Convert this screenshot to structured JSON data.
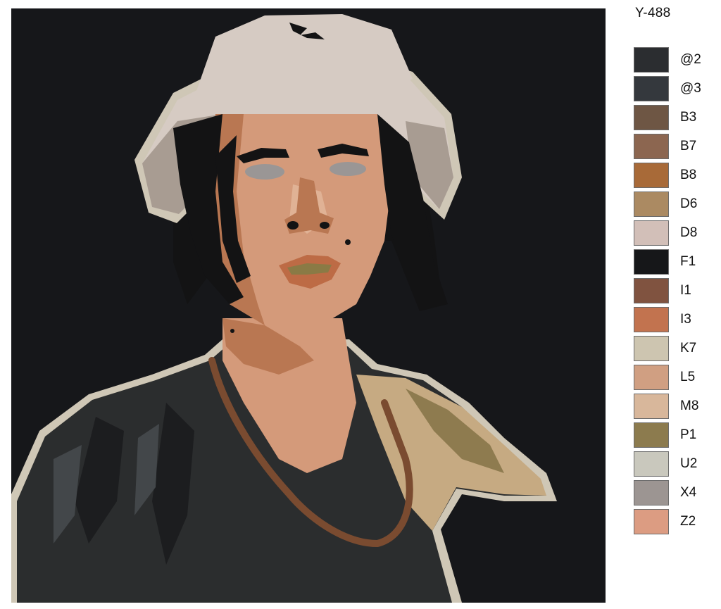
{
  "product_code": "Y-488",
  "artwork": {
    "colors": {
      "background": "#16171a",
      "outline": "#cfc7b6",
      "skin": "#d49a7a",
      "skin_shadow": "#b97752",
      "skin_light": "#e0b295",
      "hair": "#131314",
      "hat": "#d6cbc3",
      "hat_shadow": "#a89c92",
      "shirt": "#2b2d2e",
      "shirt_dark": "#1c1d1f",
      "shirt_light": "#43474a",
      "eyes": "#9a9695",
      "lips": "#bd6b45",
      "teeth": "#8a7a45",
      "necklace": "#7a4b30",
      "shoulder": "#c6aa82",
      "shoulder_shadow": "#8e7b4f"
    }
  },
  "palette": [
    {
      "code": "@2",
      "color": "#2b2d30"
    },
    {
      "code": "@3",
      "color": "#34383d"
    },
    {
      "code": "B3",
      "color": "#6e5644"
    },
    {
      "code": "B7",
      "color": "#8c6650"
    },
    {
      "code": "B8",
      "color": "#a86a38"
    },
    {
      "code": "D6",
      "color": "#ab8a62"
    },
    {
      "code": "D8",
      "color": "#d2bfb8"
    },
    {
      "code": "F1",
      "color": "#161719"
    },
    {
      "code": "I1",
      "color": "#805340"
    },
    {
      "code": "I3",
      "color": "#c2734f"
    },
    {
      "code": "K7",
      "color": "#cdc5b0"
    },
    {
      "code": "L5",
      "color": "#d09f82"
    },
    {
      "code": "M8",
      "color": "#d8b79b"
    },
    {
      "code": "P1",
      "color": "#8c7b4e"
    },
    {
      "code": "U2",
      "color": "#c9c8bd"
    },
    {
      "code": "X4",
      "color": "#9c9592"
    },
    {
      "code": "Z2",
      "color": "#dc9c82"
    }
  ]
}
